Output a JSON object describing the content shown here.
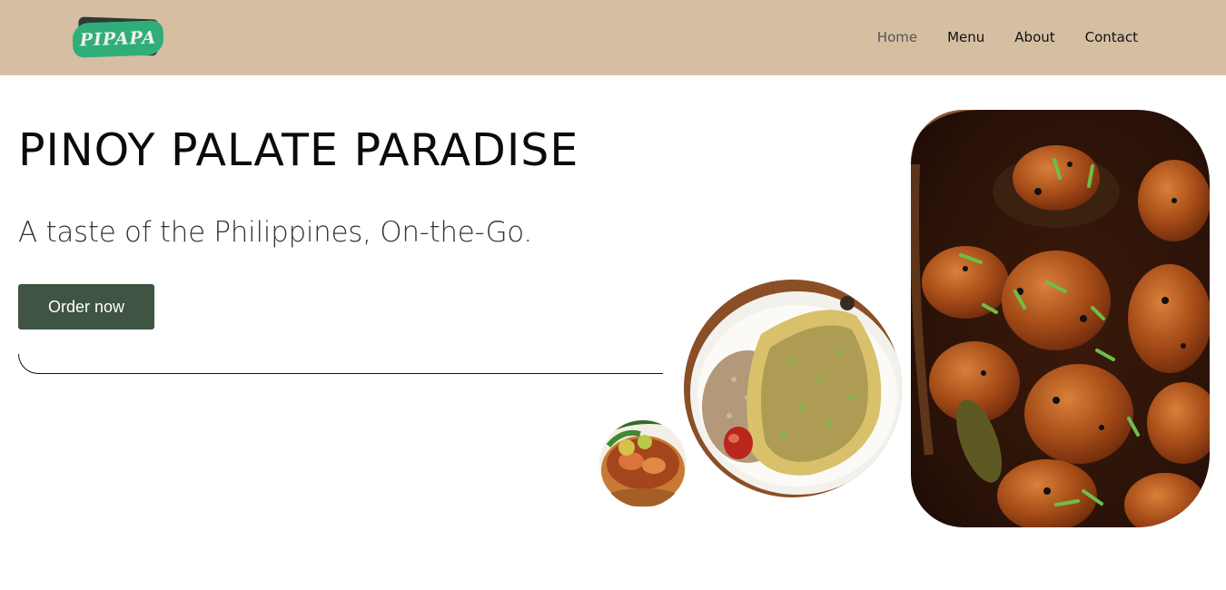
{
  "brand": {
    "logo_text": "PIPAPA",
    "colors": {
      "header_bg": "#d5bea2",
      "logo_green": "#2fae7a",
      "button_bg": "#3f5443"
    }
  },
  "nav": {
    "items": [
      {
        "label": "Home",
        "active": true
      },
      {
        "label": "Menu",
        "active": false
      },
      {
        "label": "About",
        "active": false
      },
      {
        "label": "Contact",
        "active": false
      }
    ]
  },
  "hero": {
    "title": "PINOY PALATE PARADISE",
    "subtitle": "A taste of the Philippines, On-the-Go.",
    "cta_label": "Order now"
  }
}
